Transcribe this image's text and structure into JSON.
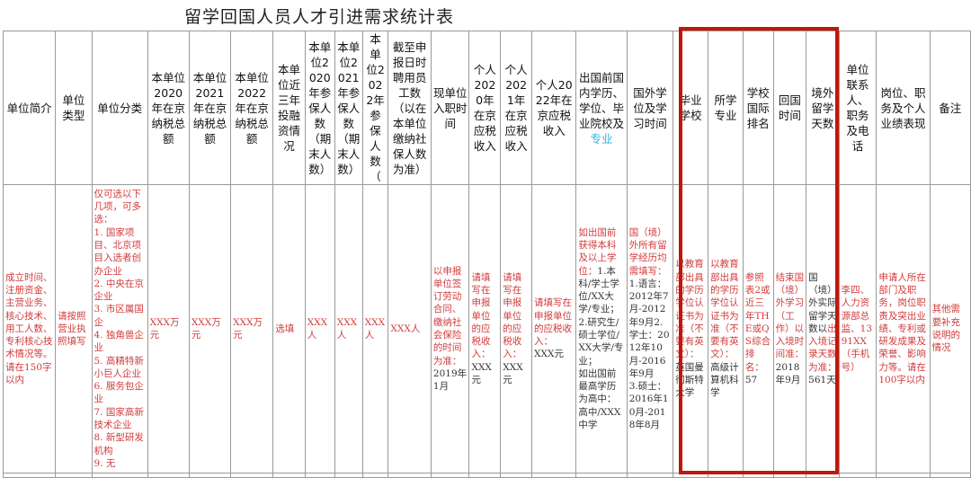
{
  "title": "留学回国人员人才引进需求统计表",
  "highlight_color": "#c0170c",
  "columns": [
    "单位简介",
    "单位类型",
    "单位分类",
    "本单位2020年在京纳税总额",
    "本单位2021年在京纳税总额",
    "本单位2022年在京纳税总额",
    "本单位近三年投融资情况",
    "本单位2020年参保人数（期末人数）",
    "本单位2021年参保人数（期末人数）",
    "本单位2022年参保人数（",
    "截至申报日时聘用员工数（以在本单位缴纳社保人数为准）",
    "现单位入职时间",
    "个人2020年在京应税收入",
    "个人2021年在京应税收入",
    "个人2022年在京应税收入",
    "出国前国内学历、学位、毕业院校及",
    "国外学位及学习时间",
    "毕业学校",
    "所学专业",
    "学校国际排名",
    "回国时间",
    "境外留学天数",
    "单位联系人、职务及电话",
    "岗位、职务及个人业绩表现",
    "备注"
  ],
  "column_15_suffix": "专业",
  "row": {
    "c0": "成立时间、注册资金、主营业务、核心技术、用工人数、专利核心技术情况等。请在150字以内",
    "c1": "请按照营业执照填写",
    "c2": "仅可选以下几项，可多选：\n1. 国家项目、北京项目入选者创办企业\n2. 中央在京企业\n3. 市区属国企\n4. 独角兽企业\n5. 高精特新小巨人企业\n6. 服务包企业\n7. 国家高新技术企业\n8. 新型研发机构\n9. 无",
    "c3": "XXX万元",
    "c4": "XXX万元",
    "c5": "XXX万元",
    "c6": "选填",
    "c7": "XXX人",
    "c8": "XXX人",
    "c9": "XXX人",
    "c10": "XXX人",
    "c11_hint": "以申报单位签订劳动合同、缴纳社会保险的时间为准：",
    "c11_value": "2019年1月",
    "c12_hint": "请填写在申报单位的应税收入：",
    "c12_value": "XXX元",
    "c13_hint": "请填写在申报单位的应税收入：",
    "c13_value": "XXX元",
    "c14_hint": "请填写在申报单位的应税收入：",
    "c14_value": "XXX元",
    "c15_hint": "如出国前获得本科及以上学位：",
    "c15_value": "1.本科/学士学位/XX大学/专业；\n2.研究生/硕士学位/XX大学/专业；\n如出国前最高学历为高中：\n高中/XXX中学",
    "c16_hint": "国（境）外所有留学经历均需填写：",
    "c16_value": "1.语言：2012年7月-2012年9月2.学士：2012年10月-2016年9月\n3.硕士：2016年10月-2018年8月",
    "c17_hint": "以教育部出具的学历学位认证书为准（不要有英文）：",
    "c17_value": "英国曼彻斯特大学",
    "c18_hint": "以教育部出具的学历学位认证书为准（不要有英文）：",
    "c18_value": "高级计算机科学",
    "c19_hint": "参照表2或近三年THE或QS综合排名：",
    "c19_value": "57",
    "c20_hint": "结束国（境）外学习（工作）以入境时间准：",
    "c20_value": "2018年9月",
    "c21_pre": "国（境）外实际留学天数以",
    "c21_hint": "出入境记录天数为准：",
    "c21_value": "561天",
    "c22": "李四、人力资源部总监、1391XX（手机号）",
    "c23": "申请人所在部门及职务，岗位职责及突出业绩、专利或研发成果及荣誉、影响力等。请在100字以内",
    "c24": "其他需要补充说明的情况"
  }
}
